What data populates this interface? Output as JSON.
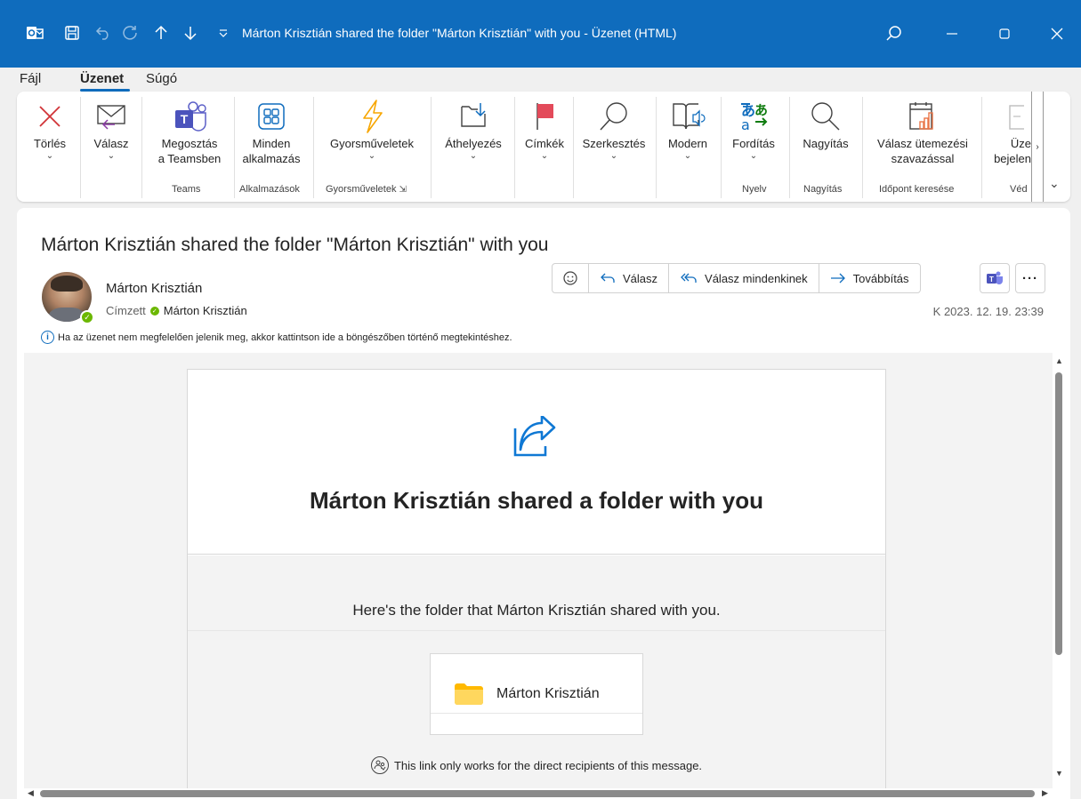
{
  "window": {
    "title": "Márton Krisztián shared the folder \"Márton Krisztián\" with you  -  Üzenet (HTML)",
    "accent": "#0f6cbd"
  },
  "menu": {
    "tabs": [
      {
        "label": "Fájl",
        "active": false
      },
      {
        "label": "Üzenet",
        "active": true
      },
      {
        "label": "Súgó",
        "active": false
      }
    ]
  },
  "ribbon": {
    "buttons": [
      {
        "label": "Törlés",
        "icon": "delete-x-icon"
      },
      {
        "label": "Válasz",
        "icon": "reply-envelope-icon"
      },
      {
        "label": "Megosztás",
        "label2": "a Teamsben",
        "icon": "teams-icon"
      },
      {
        "label": "Minden",
        "label2": "alkalmazás",
        "icon": "apps-grid-icon"
      },
      {
        "label": "Gyorsműveletek",
        "icon": "lightning-icon"
      },
      {
        "label": "Áthelyezés",
        "icon": "move-to-folder-icon"
      },
      {
        "label": "Címkék",
        "icon": "flag-icon"
      },
      {
        "label": "Szerkesztés",
        "icon": "search-icon"
      },
      {
        "label": "Modern",
        "icon": "immersive-reader-icon"
      },
      {
        "label": "Fordítás",
        "icon": "translate-icon"
      },
      {
        "label": "Nagyítás",
        "icon": "zoom-icon"
      },
      {
        "label": "Válasz ütemezési",
        "label2": "szavazással",
        "icon": "calendar-poll-icon"
      },
      {
        "label": "Üze",
        "label2": "bejelen",
        "icon": "report-icon"
      }
    ],
    "groups": [
      "Teams",
      "Alkalmazások",
      "Gyorsműveletek",
      "Nyelv",
      "Nagyítás",
      "Időpont keresése",
      "Véd"
    ]
  },
  "message": {
    "subject": "Márton Krisztián shared the folder \"Márton Krisztián\" with you",
    "sender": "Márton Krisztián",
    "to_label": "Címzett",
    "to_name": "Márton Krisztián",
    "date": "K 2023. 12. 19. 23:39",
    "info": "Ha az üzenet nem megfelelően jelenik meg, akkor kattintson ide a böngészőben történő megtekintéshez.",
    "actions": {
      "reply": "Válasz",
      "reply_all": "Válasz mindenkinek",
      "forward": "Továbbítás"
    }
  },
  "body": {
    "title": "Márton Krisztián shared a folder with you",
    "description": "Here's the folder that Márton Krisztián shared with you.",
    "folder_name": "Márton Krisztián",
    "link_note": "This link only works for the direct recipients of this message."
  }
}
